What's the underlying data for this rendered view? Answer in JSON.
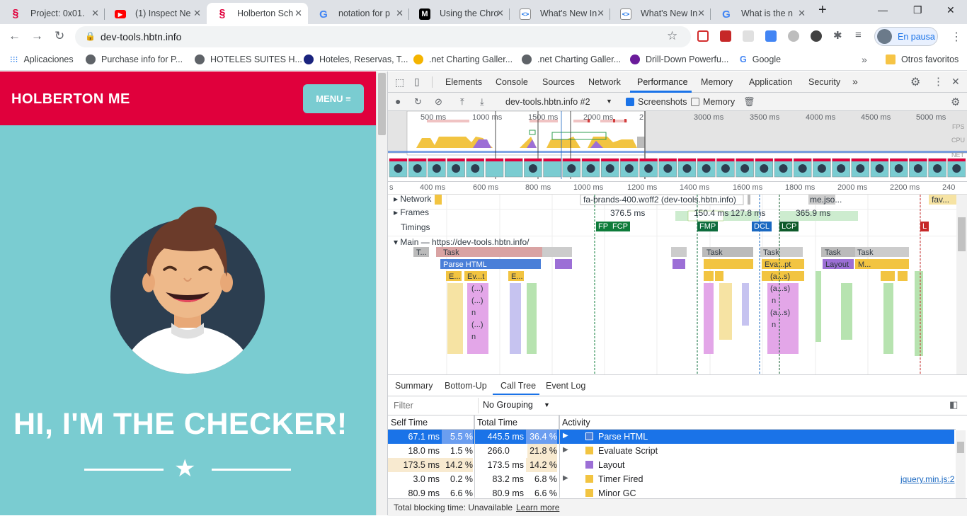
{
  "tabs": [
    {
      "title": "Project: 0x01.",
      "favicon": "holberton"
    },
    {
      "title": "(1) Inspect Ne",
      "favicon": "youtube"
    },
    {
      "title": "Holberton Sch",
      "favicon": "holberton",
      "active": true
    },
    {
      "title": "notation for p",
      "favicon": "google"
    },
    {
      "title": "Using the Chro",
      "favicon": "medium"
    },
    {
      "title": "What's New In",
      "favicon": "chrome-devtools"
    },
    {
      "title": "What's New In",
      "favicon": "chrome-devtools"
    },
    {
      "title": "What is the n",
      "favicon": "google"
    }
  ],
  "address": "dev-tools.hbtn.info",
  "profile": "En pausa",
  "bookmarks": [
    {
      "label": "Aplicaciones"
    },
    {
      "label": "Purchase info for P..."
    },
    {
      "label": "HOTELES SUITES H..."
    },
    {
      "label": "Hoteles, Reservas, T..."
    },
    {
      "label": ".net Charting Galler..."
    },
    {
      "label": ".net Charting Galler..."
    },
    {
      "label": "Drill-Down Powerfu..."
    },
    {
      "label": "Google"
    },
    {
      "label": "Otros favoritos"
    }
  ],
  "page": {
    "brand": "HOLBERTON ME",
    "menu": "MENU ≡",
    "hero": "HI, I'M THE CHECKER!"
  },
  "devtools": {
    "tabs": [
      "Elements",
      "Console",
      "Sources",
      "Network",
      "Performance",
      "Memory",
      "Application",
      "Security",
      "»"
    ],
    "selected_tab": "Performance",
    "recording_select": "dev-tools.hbtn.info #2",
    "screenshots_label": "Screenshots",
    "memory_label": "Memory",
    "overview_ticks": [
      "500 ms",
      "1000 ms",
      "1500 ms",
      "2000 ms",
      "2",
      "3000 ms",
      "3500 ms",
      "4000 ms",
      "4500 ms",
      "5000 ms"
    ],
    "overview_lanes": [
      "FPS",
      "CPU",
      "NET"
    ],
    "ruler_ticks": [
      "s",
      "400 ms",
      "600 ms",
      "800 ms",
      "1000 ms",
      "1200 ms",
      "1400 ms",
      "1600 ms",
      "1800 ms",
      "2000 ms",
      "2200 ms",
      "240"
    ],
    "tracks": {
      "network": "Network",
      "frames": "Frames",
      "timings": "Timings",
      "main": "Main — https://dev-tools.hbtn.info/"
    },
    "network_items": [
      "fa-brands-400.woff2 (dev-tools.hbtn.info)",
      "me.jso...",
      "fav..."
    ],
    "frames": [
      "376.5 ms",
      "150.4 ms",
      "127.8 ms",
      "365.9 ms"
    ],
    "timings": [
      {
        "label": "FP",
        "color": "#0e7c3a"
      },
      {
        "label": "FCP",
        "color": "#0e7c3a"
      },
      {
        "label": "FMP",
        "color": "#0d6c3c"
      },
      {
        "label": "DCL",
        "color": "#1a68c1"
      },
      {
        "label": "LCP",
        "color": "#0e5a2a"
      },
      {
        "label": "L",
        "color": "#c62828"
      }
    ],
    "flame_labels": [
      "T...",
      "Task",
      "Parse HTML",
      "E...",
      "Ev...t",
      "E...",
      "(...)",
      "(...)",
      "n",
      "(...)",
      "n",
      "Task",
      "Task",
      "Eva...pt",
      "(a...s)",
      "(a...s)",
      "n",
      "(a...s)",
      "n",
      "Task",
      "Task",
      "Layout",
      "M..."
    ],
    "bottom_tabs": [
      "Summary",
      "Bottom-Up",
      "Call Tree",
      "Event Log"
    ],
    "selected_bottom_tab": "Call Tree",
    "filter_placeholder": "Filter",
    "grouping": "No Grouping",
    "columns": {
      "self": "Self Time",
      "total": "Total Time",
      "activity": "Activity"
    },
    "rows": [
      {
        "self": "67.1 ms",
        "self_pct": "5.5 %",
        "total": "445.5 ms",
        "total_pct": "36.4 %",
        "activity": "Parse HTML",
        "color": "#4a7fd8",
        "expandable": true,
        "selected": true,
        "link": ""
      },
      {
        "self": "18.0 ms",
        "self_pct": "1.5 %",
        "total": "266.0 ms",
        "total_pct": "21.8 %",
        "activity": "Evaluate Script",
        "color": "#f2c441",
        "expandable": true,
        "link": ""
      },
      {
        "self": "173.5 ms",
        "self_pct": "14.2 %",
        "total": "173.5 ms",
        "total_pct": "14.2 %",
        "activity": "Layout",
        "color": "#9c6fd6",
        "expandable": false,
        "link": ""
      },
      {
        "self": "3.0 ms",
        "self_pct": "0.2 %",
        "total": "83.2 ms",
        "total_pct": "6.8 %",
        "activity": "Timer Fired",
        "color": "#f2c441",
        "expandable": true,
        "link": "jquery.min.js:2"
      },
      {
        "self": "80.9 ms",
        "self_pct": "6.6 %",
        "total": "80.9 ms",
        "total_pct": "6.6 %",
        "activity": "Minor GC",
        "color": "#f2c441",
        "expandable": false,
        "link": ""
      }
    ],
    "status": "Total blocking time: Unavailable",
    "learn_more": "Learn more"
  }
}
